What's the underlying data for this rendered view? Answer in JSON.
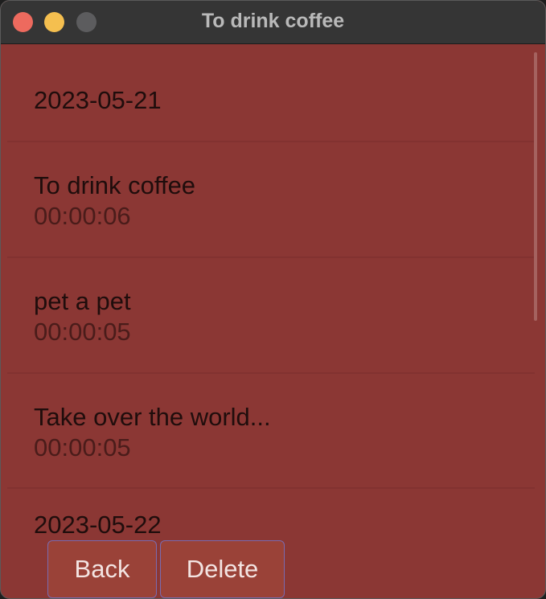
{
  "window": {
    "title": "To drink coffee"
  },
  "list": [
    {
      "type": "date",
      "text": "2023-05-21"
    },
    {
      "type": "task",
      "name": "To drink coffee",
      "time": "00:00:06"
    },
    {
      "type": "task",
      "name": "pet a pet",
      "time": "00:00:05"
    },
    {
      "type": "task",
      "name": "Take over the world...",
      "time": "00:00:05"
    },
    {
      "type": "date",
      "text": "2023-05-22"
    }
  ],
  "buttons": {
    "back": "Back",
    "delete": "Delete"
  },
  "colors": {
    "background": "#8b3734",
    "titlebar": "#353535",
    "button": "#9a4238"
  }
}
